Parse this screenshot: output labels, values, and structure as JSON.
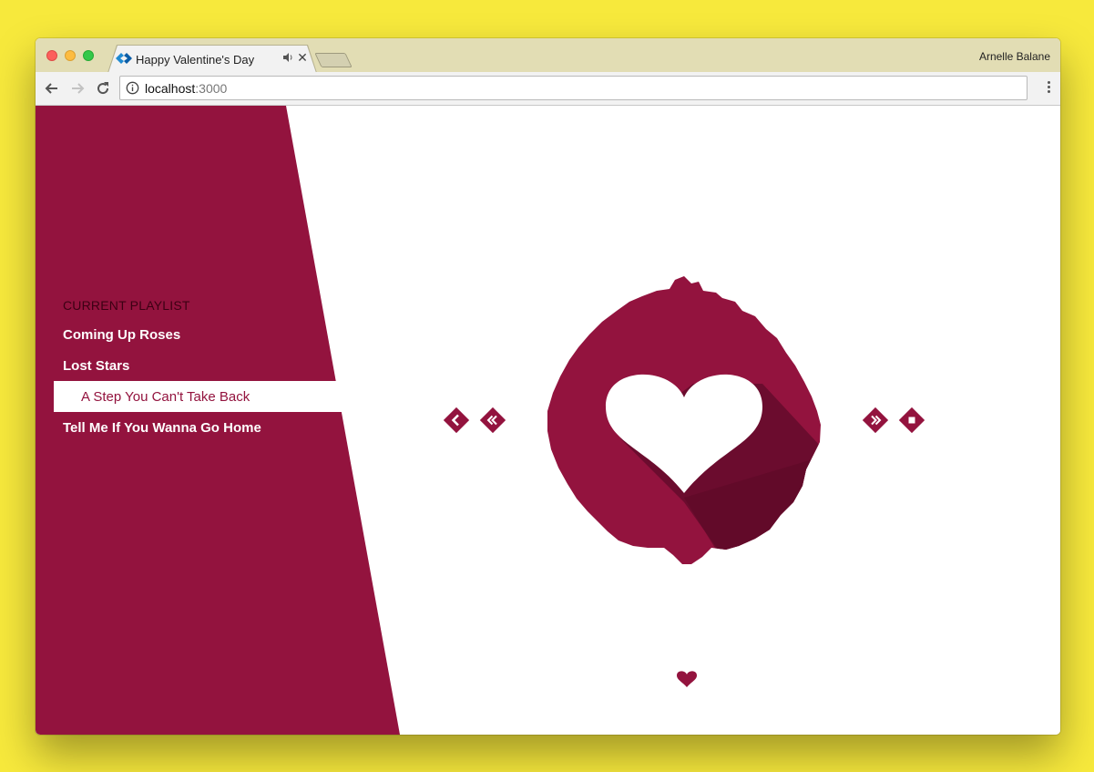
{
  "browser": {
    "tab_title": "Happy Valentine's Day",
    "profile_name": "Arnelle Balane",
    "url_host": "localhost",
    "url_port": ":3000"
  },
  "colors": {
    "accent": "#93133e",
    "accent_dark": "#5e0a28",
    "background": "#f7e93c"
  },
  "playlist": {
    "heading": "CURRENT PLAYLIST",
    "items": [
      {
        "title": "Coming Up Roses",
        "active": false
      },
      {
        "title": "Lost Stars",
        "active": false
      },
      {
        "title": "A Step You Can't Take Back",
        "active": true
      },
      {
        "title": "Tell Me If You Wanna Go Home",
        "active": false
      }
    ]
  },
  "controls": {
    "left": [
      "chevron-left-icon",
      "double-chevron-left-icon"
    ],
    "right": [
      "double-chevron-right-icon",
      "stop-icon"
    ]
  },
  "icons": {
    "center": "heart-icon",
    "footer": "heart-icon"
  }
}
